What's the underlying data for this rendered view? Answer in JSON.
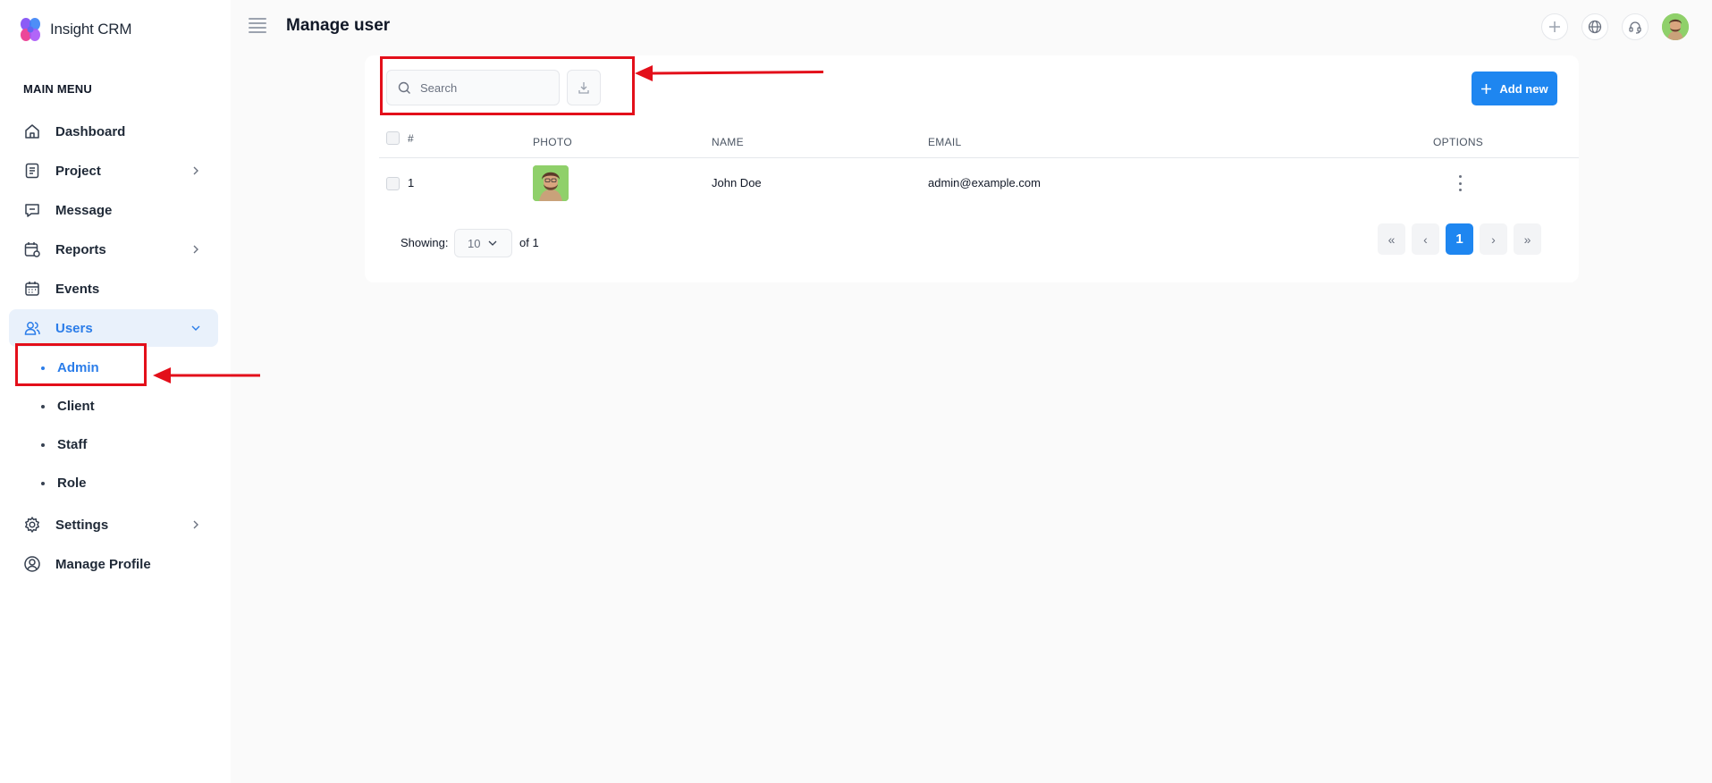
{
  "app": {
    "name": "Insight CRM"
  },
  "sidebar": {
    "heading": "MAIN MENU",
    "items": [
      {
        "label": "Dashboard",
        "icon": "home-icon",
        "has_chevron": false
      },
      {
        "label": "Project",
        "icon": "document-icon",
        "has_chevron": true
      },
      {
        "label": "Message",
        "icon": "chat-icon",
        "has_chevron": false
      },
      {
        "label": "Reports",
        "icon": "calendar-chart-icon",
        "has_chevron": true
      },
      {
        "label": "Events",
        "icon": "calendar-icon",
        "has_chevron": false
      },
      {
        "label": "Users",
        "icon": "users-icon",
        "has_chevron": true,
        "expanded": true,
        "active": true
      },
      {
        "label": "Settings",
        "icon": "gear-icon",
        "has_chevron": true
      },
      {
        "label": "Manage Profile",
        "icon": "user-circle-icon",
        "has_chevron": false
      }
    ],
    "users_sub": [
      {
        "label": "Admin",
        "active": true
      },
      {
        "label": "Client"
      },
      {
        "label": "Staff"
      },
      {
        "label": "Role"
      }
    ]
  },
  "header": {
    "title": "Manage user",
    "icons": [
      "plus-icon",
      "globe-icon",
      "headset-icon",
      "avatar"
    ]
  },
  "toolbar": {
    "search_placeholder": "Search",
    "add_label": "Add new"
  },
  "table": {
    "columns": {
      "index": "#",
      "photo": "PHOTO",
      "name": "NAME",
      "email": "EMAIL",
      "options": "OPTIONS"
    },
    "rows": [
      {
        "index": "1",
        "name": "John Doe",
        "email": "admin@example.com"
      }
    ]
  },
  "footer": {
    "showing_label": "Showing:",
    "page_size": "10",
    "of_total": "of 1",
    "pager": {
      "first": "«",
      "prev": "‹",
      "current": "1",
      "next": "›",
      "last": "»"
    }
  },
  "colors": {
    "accent": "#1e86f0",
    "active_text": "#2b7de9",
    "active_bg": "#e9f1fb",
    "annotation": "#e30f1a"
  }
}
